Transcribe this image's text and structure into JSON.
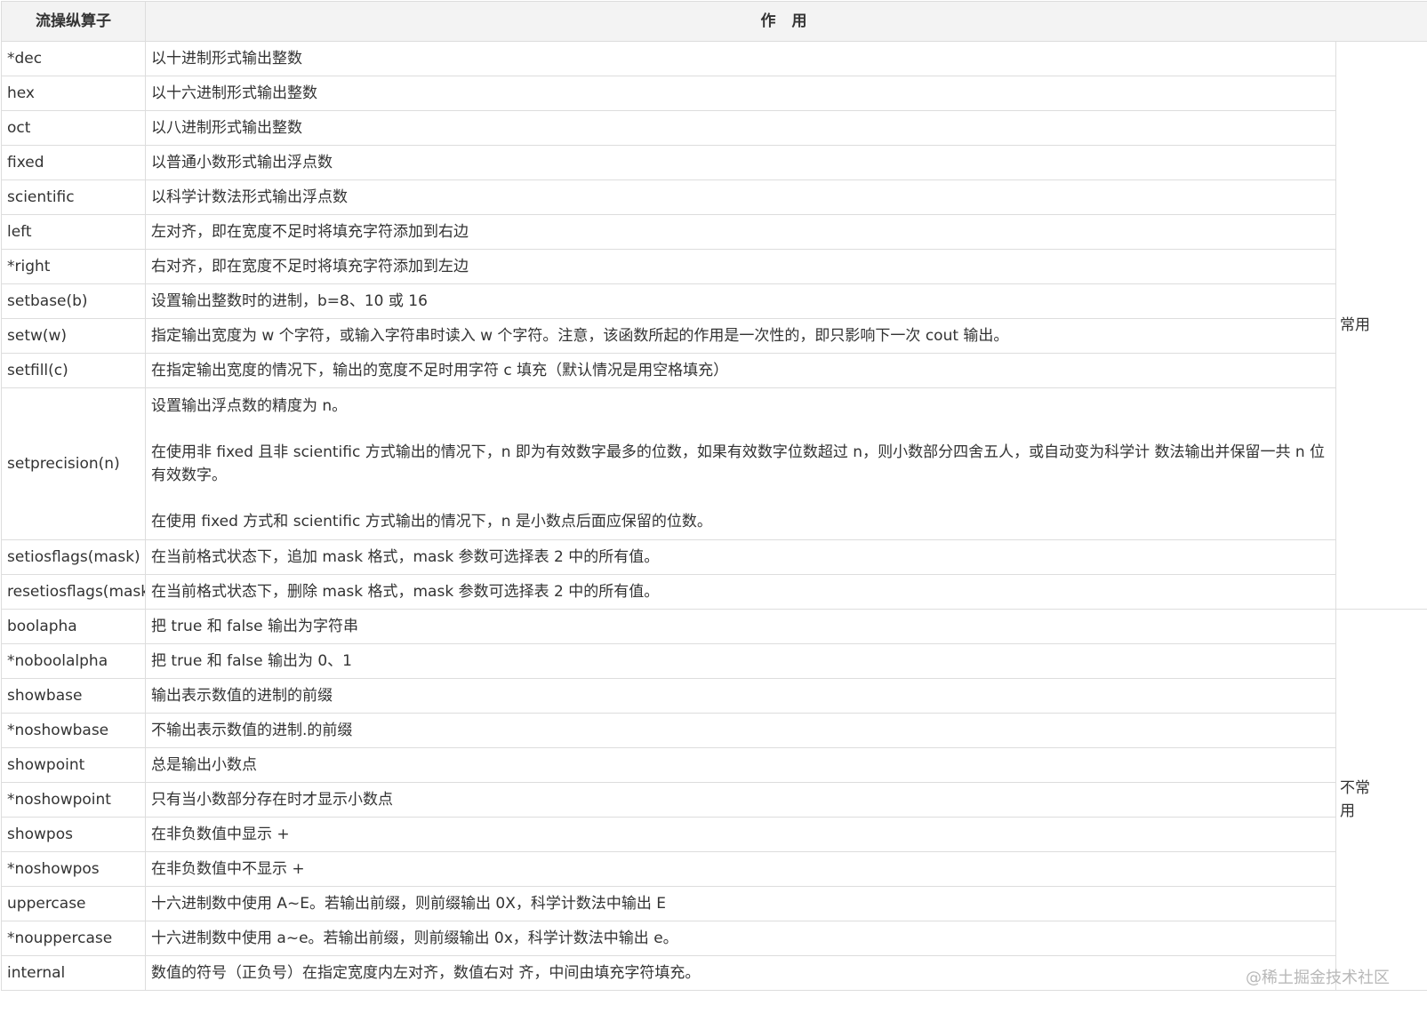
{
  "table": {
    "headers": {
      "name": "流操纵算子",
      "effect": "作 用"
    },
    "groups": [
      {
        "label": "常用",
        "rows": [
          {
            "name": "*dec",
            "desc": [
              "以十进制形式输出整数"
            ]
          },
          {
            "name": "hex",
            "desc": [
              "以十六进制形式输出整数"
            ]
          },
          {
            "name": "oct",
            "desc": [
              "以八进制形式输出整数"
            ]
          },
          {
            "name": "fixed",
            "desc": [
              "以普通小数形式输出浮点数"
            ]
          },
          {
            "name": "scientific",
            "desc": [
              "以科学计数法形式输出浮点数"
            ]
          },
          {
            "name": "left",
            "desc": [
              "左对齐，即在宽度不足时将填充字符添加到右边"
            ]
          },
          {
            "name": "*right",
            "desc": [
              "右对齐，即在宽度不足时将填充字符添加到左边"
            ]
          },
          {
            "name": "setbase(b)",
            "desc": [
              "设置输出整数时的进制，b=8、10 或 16"
            ]
          },
          {
            "name": "setw(w)",
            "desc": [
              "指定输出宽度为 w 个字符，或输入字符串时读入 w 个字符。注意，该函数所起的作用是一次性的，即只影响下一次 cout 输出。"
            ]
          },
          {
            "name": "setfill(c)",
            "desc": [
              "在指定输出宽度的情况下，输出的宽度不足时用字符 c 填充（默认情况是用空格填充）"
            ]
          },
          {
            "name": "setprecision(n)",
            "desc": [
              "设置输出浮点数的精度为 n。",
              "在使用非 fixed 且非 scientific 方式输出的情况下，n 即为有效数字最多的位数，如果有效数字位数超过 n，则小数部分四舍五人，或自动变为科学计 数法输出并保留一共 n 位有效数字。",
              "在使用 fixed 方式和 scientific 方式输出的情况下，n 是小数点后面应保留的位数。"
            ]
          },
          {
            "name": "setiosflags(mask)",
            "desc": [
              "在当前格式状态下，追加 mask 格式，mask 参数可选择表 2 中的所有值。"
            ]
          },
          {
            "name": "resetiosflags(mask)",
            "desc": [
              "在当前格式状态下，删除 mask 格式，mask 参数可选择表 2 中的所有值。"
            ]
          }
        ]
      },
      {
        "label": "不常用",
        "rows": [
          {
            "name": "boolapha",
            "desc": [
              "把 true 和 false 输出为字符串"
            ]
          },
          {
            "name": "*noboolalpha",
            "desc": [
              "把 true 和 false 输出为 0、1"
            ]
          },
          {
            "name": "showbase",
            "desc": [
              "输出表示数值的进制的前缀"
            ]
          },
          {
            "name": "*noshowbase",
            "desc": [
              "不输出表示数值的进制.的前缀"
            ]
          },
          {
            "name": "showpoint",
            "desc": [
              "总是输出小数点"
            ]
          },
          {
            "name": "*noshowpoint",
            "desc": [
              "只有当小数部分存在时才显示小数点"
            ]
          },
          {
            "name": "showpos",
            "desc": [
              "在非负数值中显示 +"
            ]
          },
          {
            "name": "*noshowpos",
            "desc": [
              "在非负数值中不显示 +"
            ]
          },
          {
            "name": "uppercase",
            "desc": [
              "十六进制数中使用 A~E。若输出前缀，则前缀输出 0X，科学计数法中输出 E"
            ]
          },
          {
            "name": "*nouppercase",
            "desc": [
              "十六进制数中使用 a~e。若输出前缀，则前缀输出 0x，科学计数法中输出 e。"
            ]
          },
          {
            "name": "internal",
            "desc": [
              "数值的符号（正负号）在指定宽度内左对齐，数值右对 齐，中间由填充字符填充。"
            ]
          }
        ]
      }
    ]
  },
  "watermark": "@稀土掘金技术社区"
}
